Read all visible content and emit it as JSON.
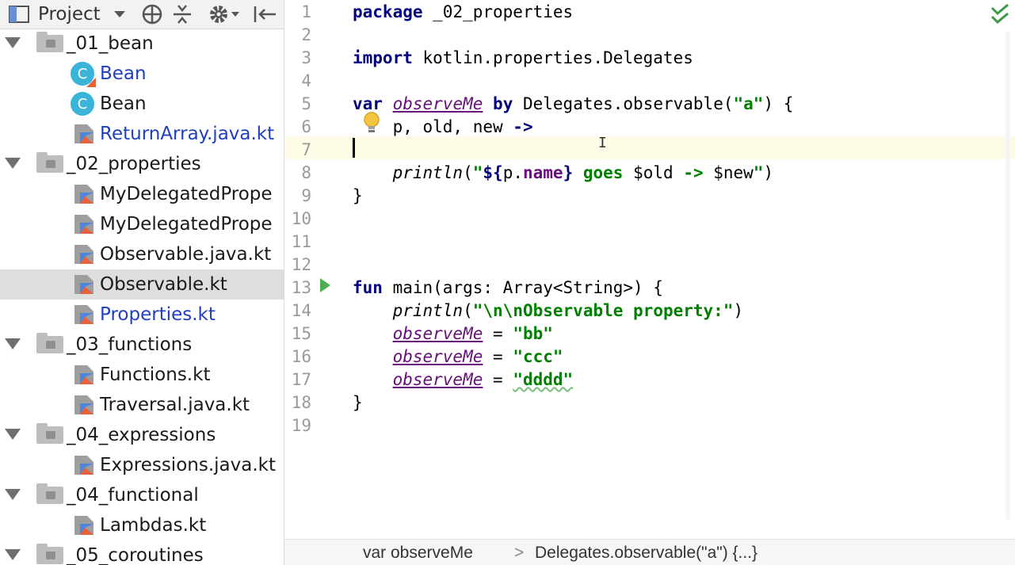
{
  "toolbar": {
    "title": "Project",
    "icons": [
      "project-view-icon",
      "dropdown-caret-icon",
      "locate-target-icon",
      "collapse-all-icon",
      "gear-icon",
      "hide-panel-icon"
    ]
  },
  "tree": [
    {
      "type": "folder",
      "label": "_01_bean",
      "expanded": true
    },
    {
      "type": "class-kt",
      "label": "Bean",
      "color": "blue"
    },
    {
      "type": "class",
      "label": "Bean",
      "color": "black"
    },
    {
      "type": "kt-file",
      "label": "ReturnArray.java.kt",
      "color": "blue"
    },
    {
      "type": "folder",
      "label": "_02_properties",
      "expanded": true
    },
    {
      "type": "kt-file",
      "label": "MyDelegatedPrope",
      "color": "black"
    },
    {
      "type": "kt-file",
      "label": "MyDelegatedPrope",
      "color": "black"
    },
    {
      "type": "kt-file",
      "label": "Observable.java.kt",
      "color": "black"
    },
    {
      "type": "kt-file",
      "label": "Observable.kt",
      "color": "black",
      "selected": true
    },
    {
      "type": "kt-file",
      "label": "Properties.kt",
      "color": "blue"
    },
    {
      "type": "folder",
      "label": "_03_functions",
      "expanded": true
    },
    {
      "type": "kt-file",
      "label": "Functions.kt",
      "color": "black"
    },
    {
      "type": "kt-file",
      "label": "Traversal.java.kt",
      "color": "black"
    },
    {
      "type": "folder",
      "label": "_04_expressions",
      "expanded": true
    },
    {
      "type": "kt-file",
      "label": "Expressions.java.kt",
      "color": "black"
    },
    {
      "type": "folder",
      "label": "_04_functional",
      "expanded": true
    },
    {
      "type": "kt-file",
      "label": "Lambdas.kt",
      "color": "black"
    },
    {
      "type": "folder",
      "label": "_05_coroutines",
      "expanded": true
    }
  ],
  "editor": {
    "line_numbers": [
      "1",
      "2",
      "3",
      "4",
      "5",
      "6",
      "7",
      "8",
      "9",
      "10",
      "11",
      "12",
      "13",
      "14",
      "15",
      "16",
      "17",
      "18",
      "19"
    ],
    "code": {
      "l1_kw": "package",
      "l1_rest": " _02_properties",
      "l3_kw": "import",
      "l3_rest": " kotlin.properties.Delegates",
      "l5_kw1": "var",
      "l5_prop": "observeMe",
      "l5_kw2": "by",
      "l5_mid": " Delegates.observable(",
      "l5_str": "\"a\"",
      "l5_end": ") {",
      "l6_text": "    p, old, new ",
      "l6_arrow": "->",
      "l8_fn": "println",
      "l8_open": "(",
      "l8_q1": "\"",
      "l8_t1": "${",
      "l8_p": "p.",
      "l8_name": "name",
      "l8_t2": "}",
      "l8_goes": " goes ",
      "l8_old": "$old",
      "l8_arrow": " -> ",
      "l8_new": "$new",
      "l8_q2": "\"",
      "l8_close": ")",
      "l9_text": "}",
      "l13_kw": "fun",
      "l13_rest": " main(args: Array<String>) {",
      "l14_fn": "println",
      "l14_open": "(",
      "l14_str": "\"\\n\\nObservable property:\"",
      "l14_close": ")",
      "l15_prop": "observeMe",
      "l15_eq": " = ",
      "l15_str": "\"bb\"",
      "l16_prop": "observeMe",
      "l16_eq": " = ",
      "l16_str": "\"ccc\"",
      "l17_prop": "observeMe",
      "l17_eq": " = ",
      "l17_str": "\"dddd\"",
      "l18_text": "}"
    }
  },
  "breadcrumb": {
    "item1": "var observeMe",
    "separator": ">",
    "item2": "Delegates.observable(\"a\") {...}"
  },
  "colors": {
    "keyword": "#000080",
    "string": "#008000",
    "property": "#660e7a",
    "current_line": "#fefbe6",
    "run_icon": "#4caf50"
  }
}
